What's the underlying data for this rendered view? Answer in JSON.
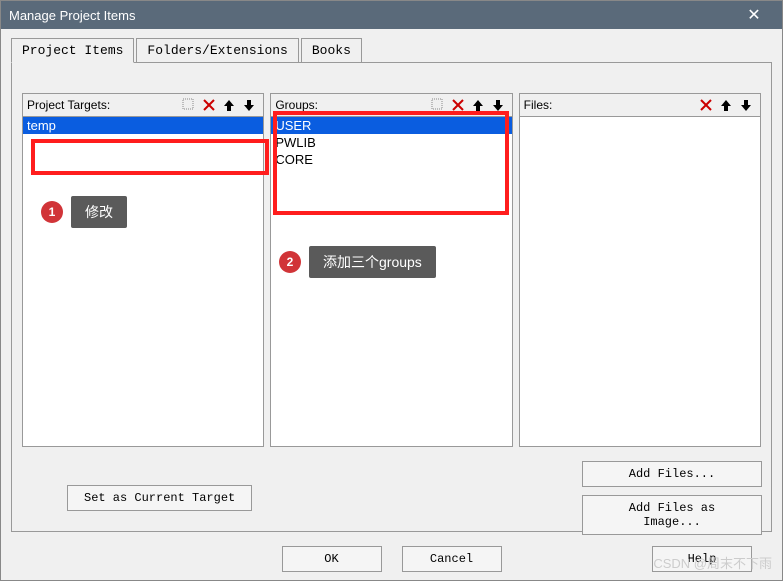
{
  "window": {
    "title": "Manage Project Items"
  },
  "tabs": {
    "project_items": "Project Items",
    "folders_ext": "Folders/Extensions",
    "books": "Books"
  },
  "columns": {
    "targets": {
      "label": "Project Targets:",
      "items": [
        "temp"
      ],
      "selected": 0
    },
    "groups": {
      "label": "Groups:",
      "items": [
        "USER",
        "PWLIB",
        "CORE"
      ],
      "selected": 0
    },
    "files": {
      "label": "Files:",
      "items": [],
      "selected": -1
    }
  },
  "buttons": {
    "set_current": "Set as Current Target",
    "add_files": "Add Files...",
    "add_files_image": "Add Files as Image...",
    "ok": "OK",
    "cancel": "Cancel",
    "help": "Help"
  },
  "annotations": {
    "a1": {
      "num": "1",
      "text": "修改"
    },
    "a2": {
      "num": "2",
      "text": "添加三个groups"
    }
  },
  "watermark": "CSDN @周末不下雨"
}
